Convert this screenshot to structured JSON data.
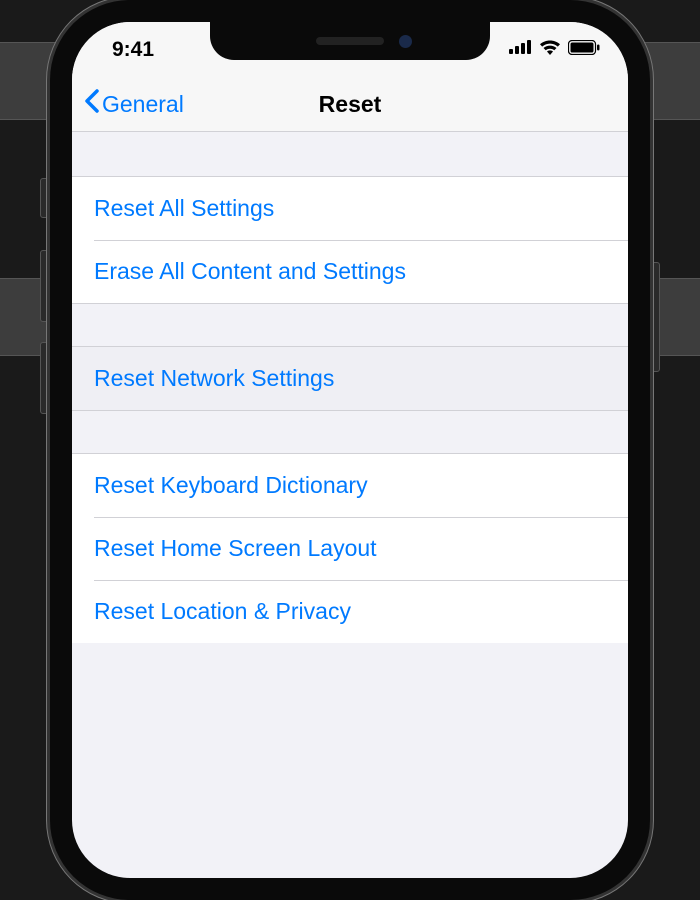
{
  "status": {
    "time": "9:41"
  },
  "nav": {
    "back_label": "General",
    "title": "Reset"
  },
  "groups": [
    {
      "items": [
        {
          "label": "Reset All Settings",
          "name": "reset-all-settings"
        },
        {
          "label": "Erase All Content and Settings",
          "name": "erase-all-content"
        }
      ]
    },
    {
      "items": [
        {
          "label": "Reset Network Settings",
          "name": "reset-network-settings",
          "highlighted": true
        }
      ]
    },
    {
      "items": [
        {
          "label": "Reset Keyboard Dictionary",
          "name": "reset-keyboard-dictionary"
        },
        {
          "label": "Reset Home Screen Layout",
          "name": "reset-home-screen-layout"
        },
        {
          "label": "Reset Location & Privacy",
          "name": "reset-location-privacy"
        }
      ]
    }
  ]
}
